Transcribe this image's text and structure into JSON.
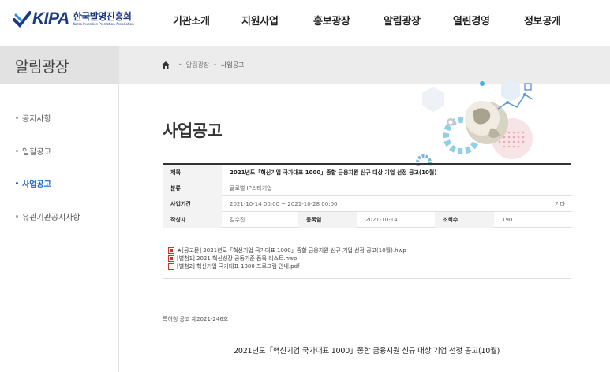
{
  "logo": {
    "name": "KIPA",
    "korean": "한국발명진흥회",
    "english": "Korea Invention Promotion Association"
  },
  "nav": [
    "기관소개",
    "지원사업",
    "홍보광장",
    "알림광장",
    "열린경영",
    "정보공개"
  ],
  "section": {
    "title": "알림광장"
  },
  "breadcrumb": {
    "items": [
      "알림광장",
      "사업공고"
    ]
  },
  "sidebar": {
    "items": [
      {
        "label": "공지사항",
        "active": false
      },
      {
        "label": "입찰공고",
        "active": false
      },
      {
        "label": "사업공고",
        "active": true
      },
      {
        "label": "유관기관공지사항",
        "active": false
      }
    ]
  },
  "page": {
    "title": "사업공고"
  },
  "post": {
    "labels": {
      "subject": "제목",
      "category": "분류",
      "period": "사업기간",
      "writer": "작성자",
      "date": "등록일",
      "views": "조회수"
    },
    "subject": "2021년도「혁신기업 국가대표 1000」종합 금융지원 신규 대상 기업 선정 공고(10월)",
    "category": "글로벌 IP스타기업",
    "period": "2021-10-14 00:00 ~ 2021-10-28 00:00",
    "status": "기타",
    "writer": "김수진",
    "date": "2021-10-14",
    "views": "190"
  },
  "attachments": [
    {
      "name": "★[공고문] 2021년도「혁신기업 국가대표 1000」종합 금융지원 신규 기업 선정 공고(10월).hwp",
      "icon": "hwp-file-icon"
    },
    {
      "name": "[별첨1] 2021 혁신성장 공동기준 품목 리스트.hwp",
      "icon": "hwp-file-icon"
    },
    {
      "name": "[별첨2] 혁신기업 국가대표 1000 프로그램 안내.pdf",
      "icon": "pdf-file-icon"
    }
  ],
  "notice_no": "특허청 공고 제2021-246호",
  "body_title": "2021년도「혁신기업 국가대표 1000」종합 금융지원 신규 대상 기업 선정 공고(10월)",
  "colors": {
    "brand": "#1d3a8a",
    "accent": "#1b63c6"
  }
}
